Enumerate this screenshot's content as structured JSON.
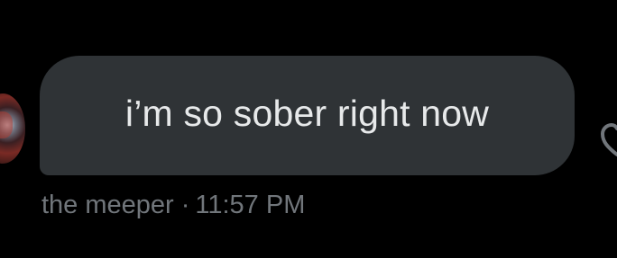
{
  "message": {
    "text": "i’m so sober right now",
    "sender": "the meeper",
    "separator": "·",
    "time": "11:57 PM"
  },
  "icons": {
    "avatar": "user-avatar",
    "reaction": "heart-icon"
  },
  "colors": {
    "background": "#000000",
    "bubble": "#2f3336",
    "message_text": "#e7e9ea",
    "meta_text": "#71767b"
  }
}
